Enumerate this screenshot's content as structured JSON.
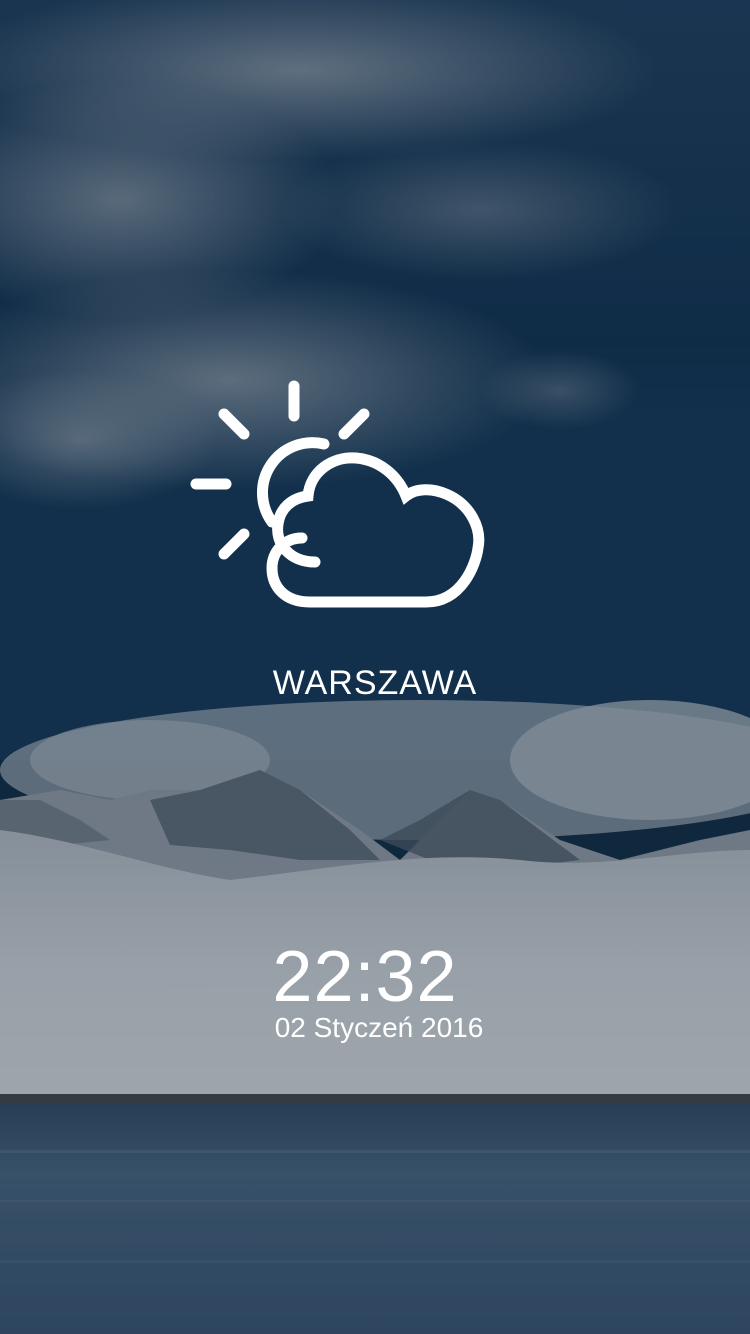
{
  "lockscreen": {
    "city": "WARSZAWA",
    "time": "22:32",
    "date": "02 Styczeń 2016",
    "weather_icon": "partly-cloudy-icon"
  },
  "colors": {
    "sky": "#0b2a47",
    "overlay": "#1c2b3a",
    "snow": "#c9ced4",
    "water": "#3b5673",
    "text": "#ffffff"
  }
}
